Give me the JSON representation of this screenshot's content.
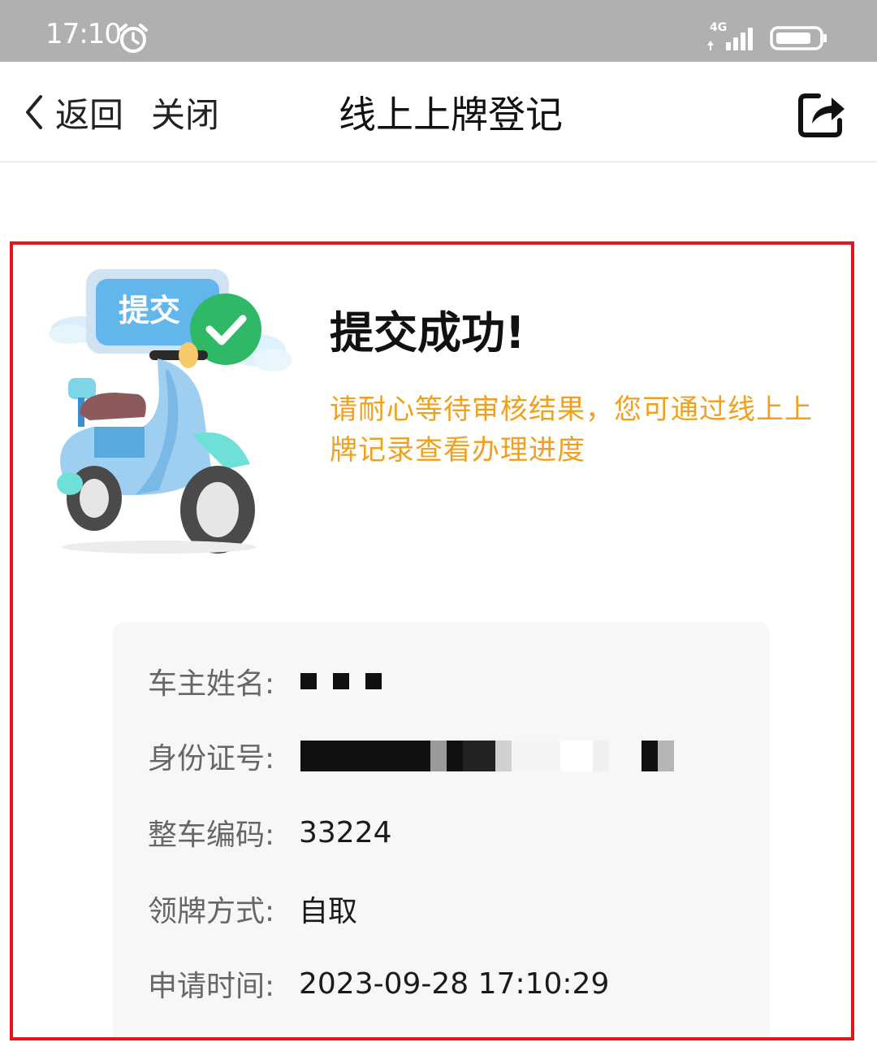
{
  "status_bar": {
    "time": "17:10",
    "network": "4G"
  },
  "nav": {
    "back_label": "返回",
    "close_label": "关闭",
    "title": "线上上牌登记"
  },
  "illustration": {
    "sign_text": "提交"
  },
  "result": {
    "title": "提交成功!",
    "message": "请耐心等待审核结果，您可通过线上上牌记录查看办理进度"
  },
  "info": {
    "owner_name_label": "车主姓名:",
    "id_number_label": "身份证号:",
    "vehicle_code_label": "整车编码:",
    "vehicle_code_value": "33224",
    "pickup_method_label": "领牌方式:",
    "pickup_method_value": "自取",
    "apply_time_label": "申请时间:",
    "apply_time_value": "2023-09-28 17:10:29"
  },
  "colors": {
    "accent_orange": "#f0a01c",
    "highlight_red": "#e5141b",
    "check_green": "#2fb866",
    "status_bar_gray": "#b0b0b0"
  }
}
